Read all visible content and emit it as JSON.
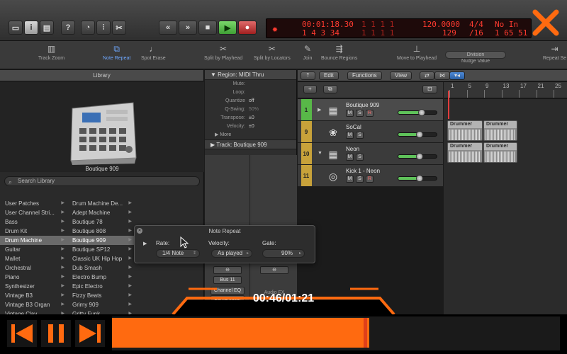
{
  "transport": {
    "time_top": "00:01:18.30",
    "time_bottom": "1  4  3   34",
    "bars_top": "1    1    1      1",
    "bars_bottom": "1    1    1     1",
    "tempo": "120.0000",
    "tempo_sub": "129",
    "signature": "4/4",
    "division": "/16",
    "key_in": "No In",
    "key_out": "1  65  51"
  },
  "tools": [
    {
      "label": "Track Zoom"
    },
    {
      "label": "Note Repeat"
    },
    {
      "label": "Spot Erase"
    },
    {
      "label": "Split by Playhead"
    },
    {
      "label": "Split by Locators"
    },
    {
      "label": "Join"
    },
    {
      "label": "Bounce Regions"
    },
    {
      "label": "Move to Playhead"
    },
    {
      "label": "Nudge Value"
    },
    {
      "label": "Repeat Se"
    }
  ],
  "nudge": {
    "value": "Division"
  },
  "library": {
    "title": "Library",
    "preset_name": "Boutique 909",
    "search_placeholder": "Search Library",
    "col1": [
      "User Patches",
      "User Channel Stri...",
      "Bass",
      "Drum Kit",
      "Drum Machine",
      "Guitar",
      "Mallet",
      "Orchestral",
      "Piano",
      "Synthesizer",
      "Vintage B3",
      "Vintage B3 Organ",
      "Vintage Clav"
    ],
    "col2": [
      "Drum Machine De...",
      "Adept Machine",
      "Boutique 78",
      "Boutique 808",
      "Boutique 909",
      "Boutique SP12",
      "Classic UK Hip Hop",
      "Dub Smash",
      "Electro Bump",
      "Epic Electro",
      "Fizzy Beats",
      "Grimy 909",
      "Gritty Funk"
    ],
    "selected_col1": 4,
    "selected_col2": 4
  },
  "inspector": {
    "region_title": "Region: MIDI Thru",
    "params": [
      {
        "k": "Mute:",
        "v": ""
      },
      {
        "k": "Loop:",
        "v": ""
      },
      {
        "k": "Quantize",
        "v": "off"
      },
      {
        "k": "Q-Swing:",
        "v": "50%"
      },
      {
        "k": "Transpose:",
        "v": "±0"
      },
      {
        "k": "Velocity:",
        "v": "±0"
      }
    ],
    "more": "More",
    "track_title": "Track: Boutique 909",
    "strip": {
      "bus": "Bus 11",
      "eq": "Channel EQ",
      "comp": "Compressor",
      "audio_fx": "Audio FX"
    }
  },
  "tracks_bar": {
    "edit": "Edit",
    "functions": "Functions",
    "view": "View"
  },
  "ruler": [
    "1",
    "5",
    "9",
    "13",
    "17",
    "21",
    "25"
  ],
  "tracks": [
    {
      "num": "1",
      "name": "Boutique 909",
      "color": "#58b848",
      "buttons": [
        "M",
        "S",
        "R"
      ],
      "fader": 0.62
    },
    {
      "num": "9",
      "name": "SoCal",
      "color": "#c8a23a",
      "buttons": [
        "M",
        "S"
      ],
      "fader": 0.55
    },
    {
      "num": "10",
      "name": "Neon",
      "color": "#c8a23a",
      "buttons": [
        "M",
        "S"
      ],
      "fader": 0.55
    },
    {
      "num": "11",
      "name": "Kick 1 - Neon",
      "color": "#c8a23a",
      "buttons": [
        "M",
        "S",
        "R"
      ],
      "fader": 0.55
    }
  ],
  "regions": [
    {
      "label": "Drummer"
    },
    {
      "label": "Drummer"
    },
    {
      "label": "Drummer"
    },
    {
      "label": "Drummer"
    }
  ],
  "note_repeat": {
    "title": "Note Repeat",
    "rate_label": "Rate:",
    "rate_value": "1/4 Note",
    "velocity_label": "Velocity:",
    "velocity_value": "As played",
    "gate_label": "Gate:",
    "gate_value": "90%"
  },
  "video": {
    "time": "00:46/01:21",
    "progress": 0.575,
    "accent": "#ff6a10"
  }
}
